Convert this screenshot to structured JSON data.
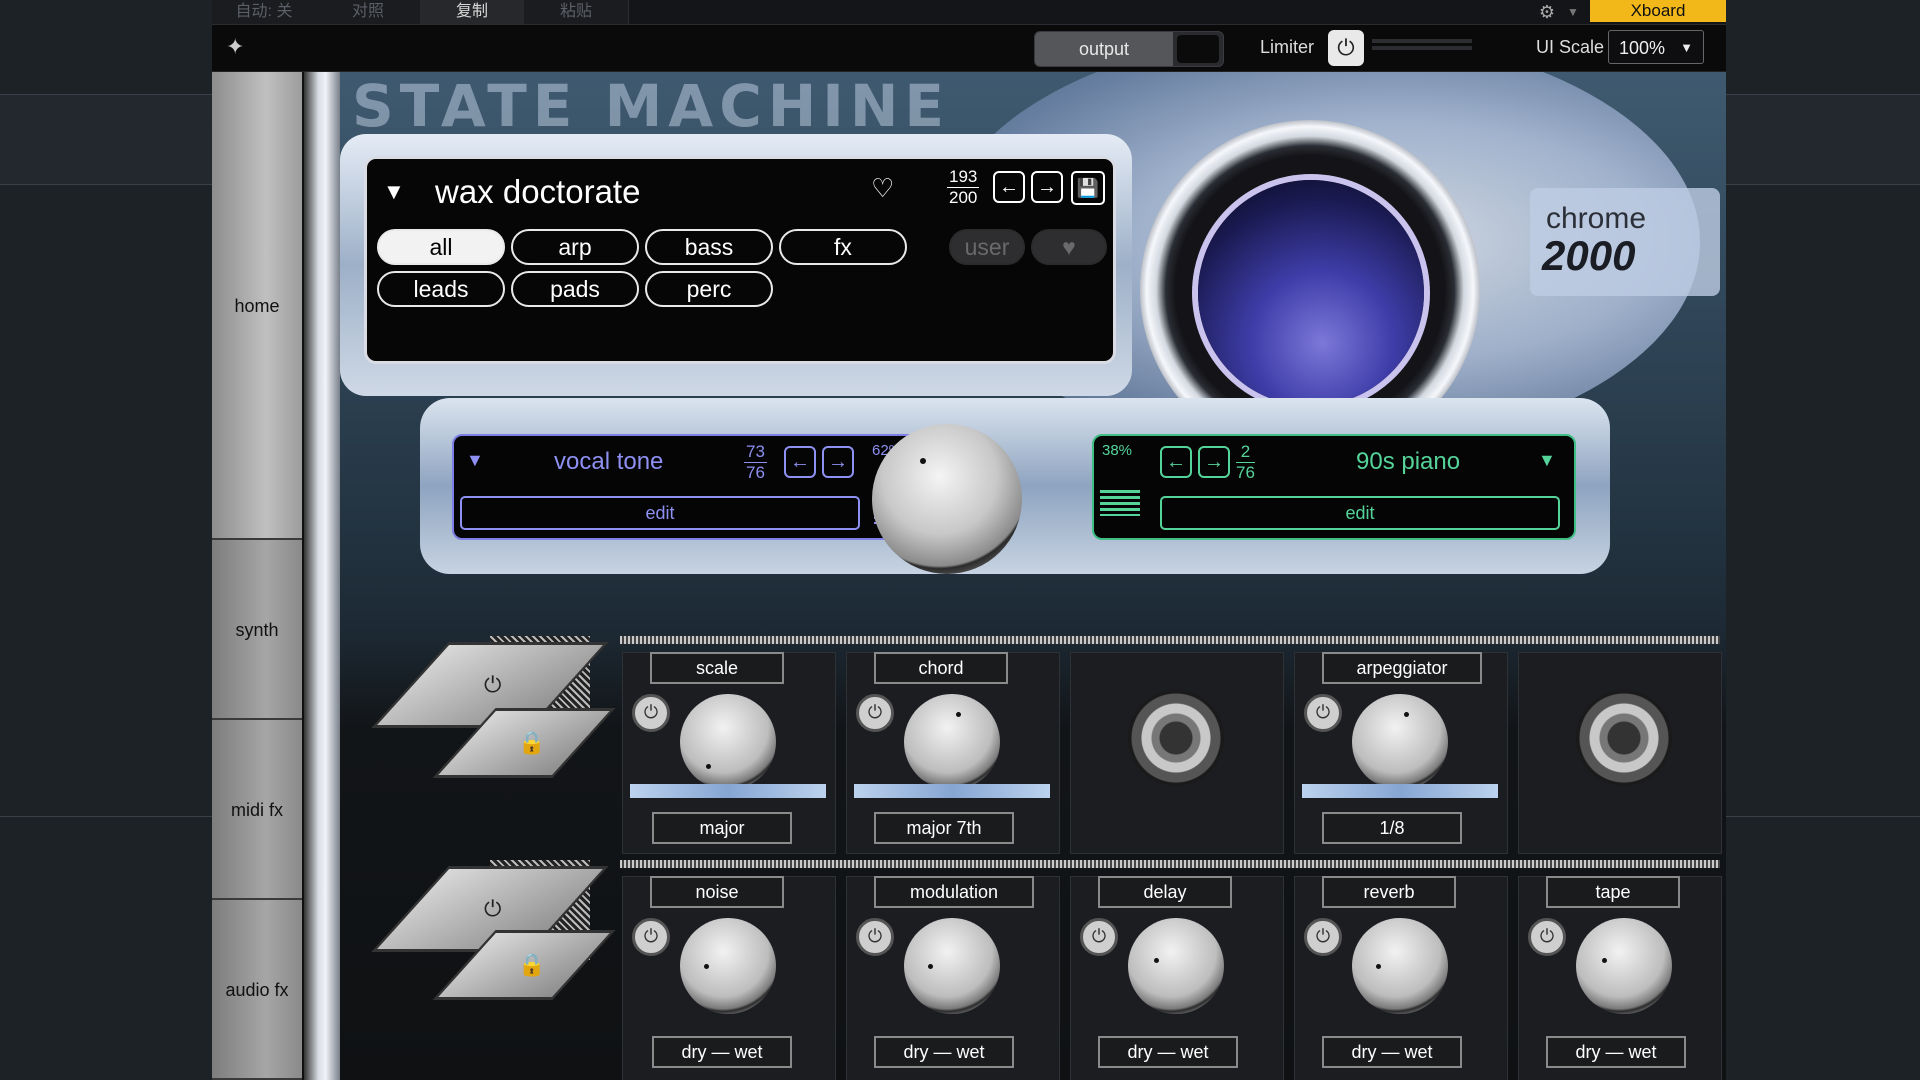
{
  "top_tabs": [
    "自动: 关",
    "对照",
    "复制",
    "粘贴"
  ],
  "top_bar": {
    "xboard": "Xboard"
  },
  "header": {
    "output_label": "output",
    "limiter_label": "Limiter",
    "ui_scale_label": "UI Scale",
    "ui_scale_value": "100%"
  },
  "sidebar": {
    "items": [
      "home",
      "synth",
      "midi fx",
      "audio fx"
    ]
  },
  "brand": {
    "line1": "chrome",
    "line2": "2000",
    "art_title": "STATE MACHINE"
  },
  "preset": {
    "name": "wax doctorate",
    "index": "193",
    "total": "200",
    "categories": [
      "all",
      "arp",
      "bass",
      "fx",
      "leads",
      "pads",
      "perc"
    ],
    "active_category": "all",
    "filters": [
      "user",
      "♥"
    ]
  },
  "layer_a": {
    "name": "vocal tone",
    "index": "73",
    "total": "76",
    "percent": "62%",
    "edit": "edit"
  },
  "layer_b": {
    "name": "90s piano",
    "index": "2",
    "total": "76",
    "percent": "38%",
    "edit": "edit"
  },
  "modules_top": [
    {
      "title": "scale",
      "value": "major"
    },
    {
      "title": "chord",
      "value": "major 7th"
    },
    {
      "title": "arpeggiator",
      "value": "1/8"
    }
  ],
  "modules_bottom": [
    {
      "title": "noise",
      "value": "dry — wet"
    },
    {
      "title": "modulation",
      "value": "dry — wet"
    },
    {
      "title": "delay",
      "value": "dry — wet"
    },
    {
      "title": "reverb",
      "value": "dry — wet"
    },
    {
      "title": "tape",
      "value": "dry — wet"
    }
  ],
  "colors": {
    "layer_a": "#7d7fe6",
    "layer_b": "#3fbf84",
    "xboard": "#f2b81a"
  },
  "icons": {
    "power": "power-icon",
    "lock": "lock-icon",
    "heart": "heart-icon",
    "save": "save-icon",
    "settings": "gear-icon"
  }
}
